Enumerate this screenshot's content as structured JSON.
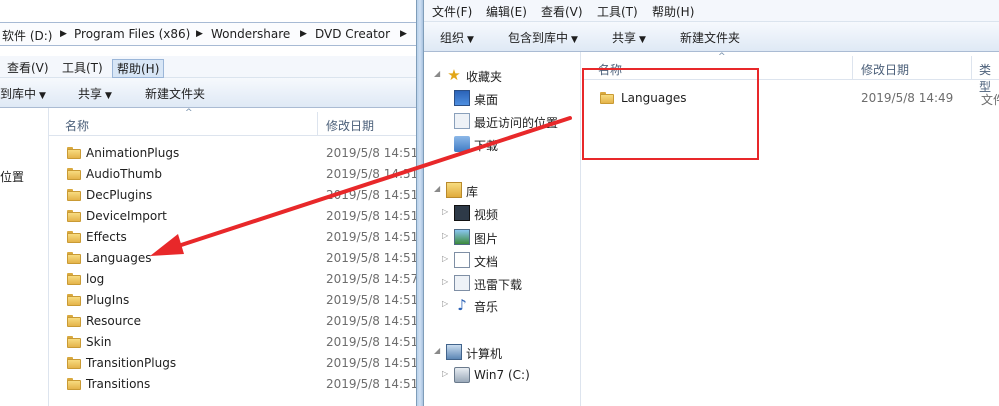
{
  "left_window": {
    "address_segments": [
      "软件 (D:)",
      "Program Files (x86)",
      "Wondershare",
      "DVD Creator"
    ],
    "menu": [
      "查看(V)",
      "工具(T)",
      "帮助(H)"
    ],
    "toolbar": {
      "include_library": "到库中",
      "share": "共享",
      "new_folder": "新建文件夹"
    },
    "nav_partial_label": "位置",
    "columns": {
      "name": "名称",
      "modified": "修改日期"
    },
    "files": [
      {
        "name": "AnimationPlugs",
        "date": "2019/5/8 14:51"
      },
      {
        "name": "AudioThumb",
        "date": "2019/5/8 14:51"
      },
      {
        "name": "DecPlugins",
        "date": "2019/5/8 14:51"
      },
      {
        "name": "DeviceImport",
        "date": "2019/5/8 14:51"
      },
      {
        "name": "Effects",
        "date": "2019/5/8 14:51"
      },
      {
        "name": "Languages",
        "date": "2019/5/8 14:51"
      },
      {
        "name": "log",
        "date": "2019/5/8 14:57"
      },
      {
        "name": "PlugIns",
        "date": "2019/5/8 14:51"
      },
      {
        "name": "Resource",
        "date": "2019/5/8 14:51"
      },
      {
        "name": "Skin",
        "date": "2019/5/8 14:51"
      },
      {
        "name": "TransitionPlugs",
        "date": "2019/5/8 14:51"
      },
      {
        "name": "Transitions",
        "date": "2019/5/8 14:51"
      }
    ]
  },
  "right_window": {
    "menu": [
      "文件(F)",
      "编辑(E)",
      "查看(V)",
      "工具(T)",
      "帮助(H)"
    ],
    "toolbar": {
      "organize": "组织",
      "include_library": "包含到库中",
      "share": "共享",
      "new_folder": "新建文件夹"
    },
    "nav": {
      "favorites": "收藏夹",
      "desktop": "桌面",
      "recent": "最近访问的位置",
      "downloads": "下载",
      "libraries": "库",
      "videos": "视频",
      "pictures": "图片",
      "documents": "文档",
      "xunlei": "迅雷下载",
      "music": "音乐",
      "computer": "计算机",
      "drive": "Win7 (C:)"
    },
    "columns": {
      "name": "名称",
      "modified": "修改日期",
      "type": "类型"
    },
    "files": [
      {
        "name": "Languages",
        "date": "2019/5/8 14:49",
        "type": "文件"
      }
    ]
  },
  "annotation": {
    "color": "#e8282a"
  }
}
